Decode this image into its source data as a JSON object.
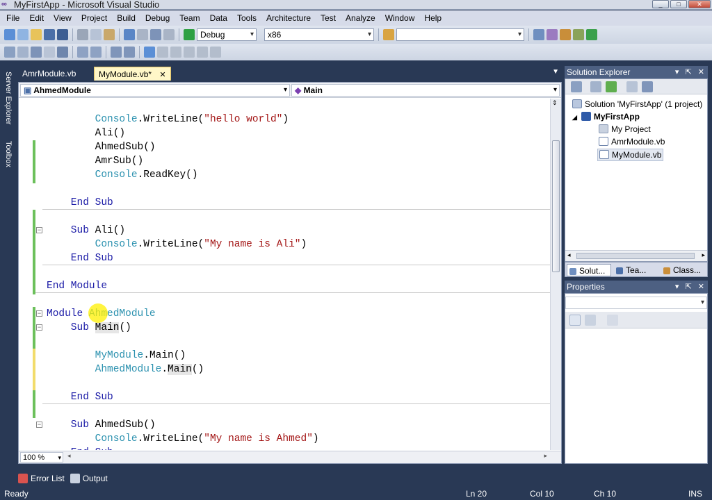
{
  "window": {
    "title": "MyFirstApp - Microsoft Visual Studio",
    "buttons": [
      "_",
      "□",
      "✕"
    ]
  },
  "menu": [
    "File",
    "Edit",
    "View",
    "Project",
    "Build",
    "Debug",
    "Team",
    "Data",
    "Tools",
    "Architecture",
    "Test",
    "Analyze",
    "Window",
    "Help"
  ],
  "toolbar": {
    "config": "Debug",
    "platform": "x86",
    "find_value": ""
  },
  "left_strip": {
    "server_explorer": "Server Explorer",
    "toolbox": "Toolbox"
  },
  "doc_tabs": [
    {
      "label": "AmrModule.vb",
      "active": false
    },
    {
      "label": "MyModule.vb*",
      "active": true,
      "close": "✕"
    }
  ],
  "nav": {
    "type_combo": "AhmedModule",
    "member_combo": "Main"
  },
  "code": {
    "lines": [
      [
        {
          "t": "        "
        },
        {
          "c": "ty",
          "t": "Console"
        },
        {
          "t": ".WriteLine("
        },
        {
          "c": "st",
          "t": "\"hello world\""
        },
        {
          "t": ")"
        }
      ],
      [
        {
          "t": "        Ali()"
        }
      ],
      [
        {
          "t": "        AhmedSub()"
        }
      ],
      [
        {
          "t": "        AmrSub()"
        }
      ],
      [
        {
          "t": "        "
        },
        {
          "c": "ty",
          "t": "Console"
        },
        {
          "t": ".ReadKey()"
        }
      ],
      [],
      [
        {
          "c": "kw",
          "t": "    End Sub"
        }
      ],
      [],
      [
        {
          "c": "kw",
          "t": "    Sub "
        },
        {
          "t": "Ali()"
        }
      ],
      [
        {
          "t": "        "
        },
        {
          "c": "ty",
          "t": "Console"
        },
        {
          "t": ".WriteLine("
        },
        {
          "c": "st",
          "t": "\"My name is Ali\""
        },
        {
          "t": ")"
        }
      ],
      [
        {
          "c": "kw",
          "t": "    End Sub"
        }
      ],
      [],
      [
        {
          "c": "kw",
          "t": "End Module"
        }
      ],
      [],
      [
        {
          "c": "kw",
          "t": "Module "
        },
        {
          "c": "ty",
          "t": "AhmedModule"
        }
      ],
      [
        {
          "c": "kw",
          "t": "    Sub "
        },
        {
          "t": "Main",
          "hl": true
        },
        {
          "t": "()"
        }
      ],
      [],
      [
        {
          "t": "        "
        },
        {
          "c": "ty",
          "t": "MyModule"
        },
        {
          "t": ".Main()"
        }
      ],
      [
        {
          "t": "        "
        },
        {
          "c": "ty",
          "t": "AhmedModule"
        },
        {
          "t": "."
        },
        {
          "t": "Main",
          "hl": true
        },
        {
          "t": "()"
        }
      ],
      [],
      [
        {
          "c": "kw",
          "t": "    End Sub"
        }
      ],
      [],
      [
        {
          "c": "kw",
          "t": "    Sub "
        },
        {
          "t": "AhmedSub()"
        }
      ],
      [
        {
          "t": "        "
        },
        {
          "c": "ty",
          "t": "Console"
        },
        {
          "t": ".WriteLine("
        },
        {
          "c": "st",
          "t": "\"My name is Ahmed\""
        },
        {
          "t": ")"
        }
      ],
      [
        {
          "c": "kw",
          "t": "    End Sub"
        }
      ]
    ]
  },
  "zoom": "100 %",
  "solution_explorer": {
    "title": "Solution Explorer",
    "solution": "Solution 'MyFirstApp' (1 project)",
    "project": "MyFirstApp",
    "items": [
      "My Project",
      "AmrModule.vb",
      "MyModule.vb"
    ],
    "tabs": [
      "Solut...",
      "Tea...",
      "Class..."
    ]
  },
  "properties": {
    "title": "Properties",
    "object": ""
  },
  "bottom_tabs": [
    "Error List",
    "Output"
  ],
  "status": {
    "text": "Ready",
    "line": "Ln 20",
    "col": "Col 10",
    "ch": "Ch 10",
    "mode": "INS"
  }
}
